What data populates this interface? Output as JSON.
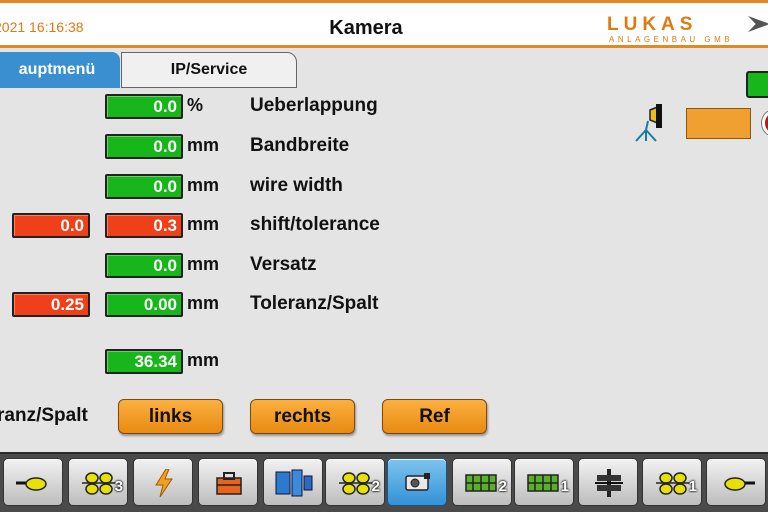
{
  "header": {
    "datetime": "2021 16:16:38",
    "title": "Kamera",
    "logo_text": "LUKAS",
    "logo_subtext": "ANLAGENBAU GMB"
  },
  "tabs": {
    "main": "auptmenü",
    "ip_service": "IP/Service"
  },
  "rows": [
    {
      "label": "Ueberlappung",
      "value": "0.0",
      "unit": "%"
    },
    {
      "label": "Bandbreite",
      "value": "0.0",
      "unit": "mm"
    },
    {
      "label": "wire width",
      "value": "0.0",
      "unit": "mm"
    },
    {
      "label": "shift/tolerance",
      "value": "0.3",
      "unit": "mm",
      "left_value": "0.0"
    },
    {
      "label": "Versatz",
      "value": "0.0",
      "unit": "mm"
    },
    {
      "label": "Toleranz/Spalt",
      "value": "0.00",
      "unit": "mm",
      "left_value": "0.25"
    },
    {
      "value": "36.34",
      "unit": "mm"
    }
  ],
  "spalt_label": "ranz/Spalt",
  "buttons": {
    "links": "links",
    "rechts": "rechts",
    "ref": "Ref"
  },
  "toolbar": [
    {
      "icon": "sensor-left-icon"
    },
    {
      "icon": "rollers-icon",
      "number": "3"
    },
    {
      "icon": "lightning-icon"
    },
    {
      "icon": "toolbox-icon"
    },
    {
      "icon": "reels-icon"
    },
    {
      "icon": "rollers-icon",
      "number": "2"
    },
    {
      "icon": "camera-icon",
      "active": true
    },
    {
      "icon": "mesh-icon",
      "number": "2"
    },
    {
      "icon": "mesh-icon",
      "number": "1"
    },
    {
      "icon": "press-icon"
    },
    {
      "icon": "rollers-icon",
      "number": "1"
    },
    {
      "icon": "sensor-right-icon"
    }
  ],
  "colors": {
    "field_ok": "#17b61a",
    "field_alarm": "#f0401a",
    "accent": "#e08a20",
    "tab_active": "#3a8fd0",
    "button": "#f59a20"
  }
}
